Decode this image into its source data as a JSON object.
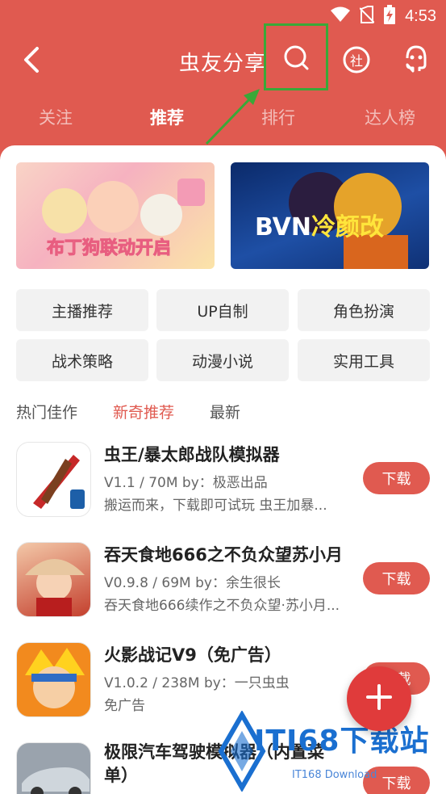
{
  "status_bar": {
    "time": "4:53",
    "icons": [
      "wifi-icon",
      "no-sim-icon",
      "battery-charging-icon"
    ]
  },
  "header": {
    "title": "虫友分享",
    "back_icon": "chevron-left-icon",
    "actions": [
      "search-icon",
      "community-icon",
      "robot-face-icon"
    ],
    "community_glyph": "社"
  },
  "tabs": [
    {
      "label": "关注",
      "active": false
    },
    {
      "label": "推荐",
      "active": true
    },
    {
      "label": "排行",
      "active": false
    },
    {
      "label": "达人榜",
      "active": false
    }
  ],
  "banners": [
    {
      "text": "布丁狗联动开启"
    },
    {
      "text_main": "BVN",
      "text_highlight": "冷颜改"
    }
  ],
  "categories": [
    "主播推荐",
    "UP自制",
    "角色扮演",
    "战术策略",
    "动漫小说",
    "实用工具"
  ],
  "subtabs": [
    {
      "label": "热门佳作",
      "active": false
    },
    {
      "label": "新奇推荐",
      "active": true
    },
    {
      "label": "最新",
      "active": false
    }
  ],
  "apps": [
    {
      "name": "虫王/暴太郎战队模拟器",
      "meta": "V1.1 / 70M  by：极恶出品",
      "desc": "搬运而来，下载即可试玩 虫王加暴...",
      "button": "下载"
    },
    {
      "name": "吞天食地666之不负众望苏小月",
      "meta": "V0.9.8 / 69M  by：余生很长",
      "desc": "吞天食地666续作之不负众望·苏小月...",
      "button": "下载"
    },
    {
      "name": "火影战记V9（免广告）",
      "meta": "V1.0.2 / 238M  by：一只虫虫",
      "desc": "免广告",
      "button": "下载"
    },
    {
      "name": "极限汽车驾驶模拟器（内置菜单）",
      "meta": "",
      "desc": "",
      "button": "下载"
    }
  ],
  "fab": {
    "icon": "plus-icon"
  },
  "watermark": {
    "title": "ITI68下载站",
    "sub": "IT168 Download"
  },
  "colors": {
    "primary": "#e05a50",
    "fab": "#e03b3b",
    "highlight_box": "#3aa838"
  }
}
